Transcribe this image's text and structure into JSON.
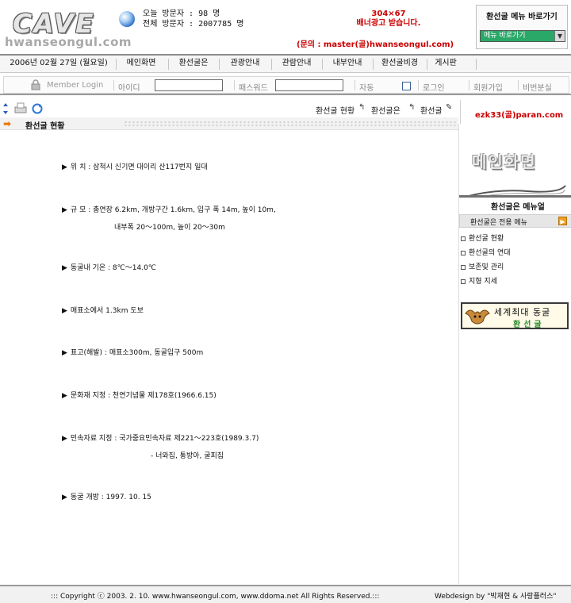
{
  "header": {
    "logo_big": "CAVE",
    "logo_small": "hwanseongul.com",
    "visitors_today": "오늘 방문자 : 98 명",
    "visitors_total": "전체 방문자 : 2007785 명",
    "banner_size": "304×67",
    "banner_notice": "배너광고 받습니다.",
    "contact": "(문의 : master(골)hwanseongul.com)",
    "quick_menu_title": "환선굴 메뉴 바로가기",
    "quick_menu_selected": "메뉴 바로가기"
  },
  "menu": {
    "date": "2006년 02월 27일 (월요일)",
    "items": [
      "메인화면",
      "환선굴은",
      "관광안내",
      "관람안내",
      "내부안내",
      "환선굴비경",
      "게시판"
    ]
  },
  "login": {
    "member_login": "Member Login",
    "id_label": "아이디",
    "pw_label": "패스워드",
    "auto_label": "자동",
    "login_button": "로그인",
    "join_button": "회원가입",
    "find_pw_button": "비번분실"
  },
  "toolbar": {
    "crumbs": [
      "환선굴 현황",
      "환선굴은",
      "환선굴"
    ],
    "email": "ezk33(골)paran.com",
    "page_title": "환선굴 현황"
  },
  "content": {
    "items": [
      {
        "text": "위 치 : 삼척시 신기면 대이리 산117번지 일대"
      },
      {
        "text": "규 모 : 총연장 6.2km, 개방구간 1.6km, 입구 폭 14m, 높이 10m,",
        "cont": "내부폭 20～100m, 높이 20～30m"
      },
      {
        "text": "동굴내 기온 : 8℃～14.0℃"
      },
      {
        "text": "매표소에서 1.3km 도보"
      },
      {
        "text": "표고(해발) : 매표소300m, 동굴입구 500m"
      },
      {
        "text": "문화재 지정 : 천연기념물 제178호(1966.6.15)"
      },
      {
        "text": "민속자료 지정 : 국가중요민속자료 제221～223호(1989.3.7)",
        "cont": "- 너와집, 통방아, 굴피집"
      },
      {
        "text": "동굴 개방 : 1997. 10. 15"
      }
    ]
  },
  "sidebar": {
    "banner_text": "메인화면",
    "menu_title": "환선굴은 메뉴얼",
    "sub_title": "환선굴은 전용 메뉴",
    "links": [
      "환선굴 현황",
      "환선굴의 연대",
      "보존및 관리",
      "지형 지세"
    ],
    "bat_title": "세계최대 동굴",
    "bat_sub": "환선굴"
  },
  "footer": {
    "copyright": "::: Copyright ⓒ 2003. 2. 10. www.hwanseongul.com, www.ddoma.net All Rights Reserved.:::",
    "webdesign": "Webdesign by \"박재현 & 사랑플러스\""
  }
}
